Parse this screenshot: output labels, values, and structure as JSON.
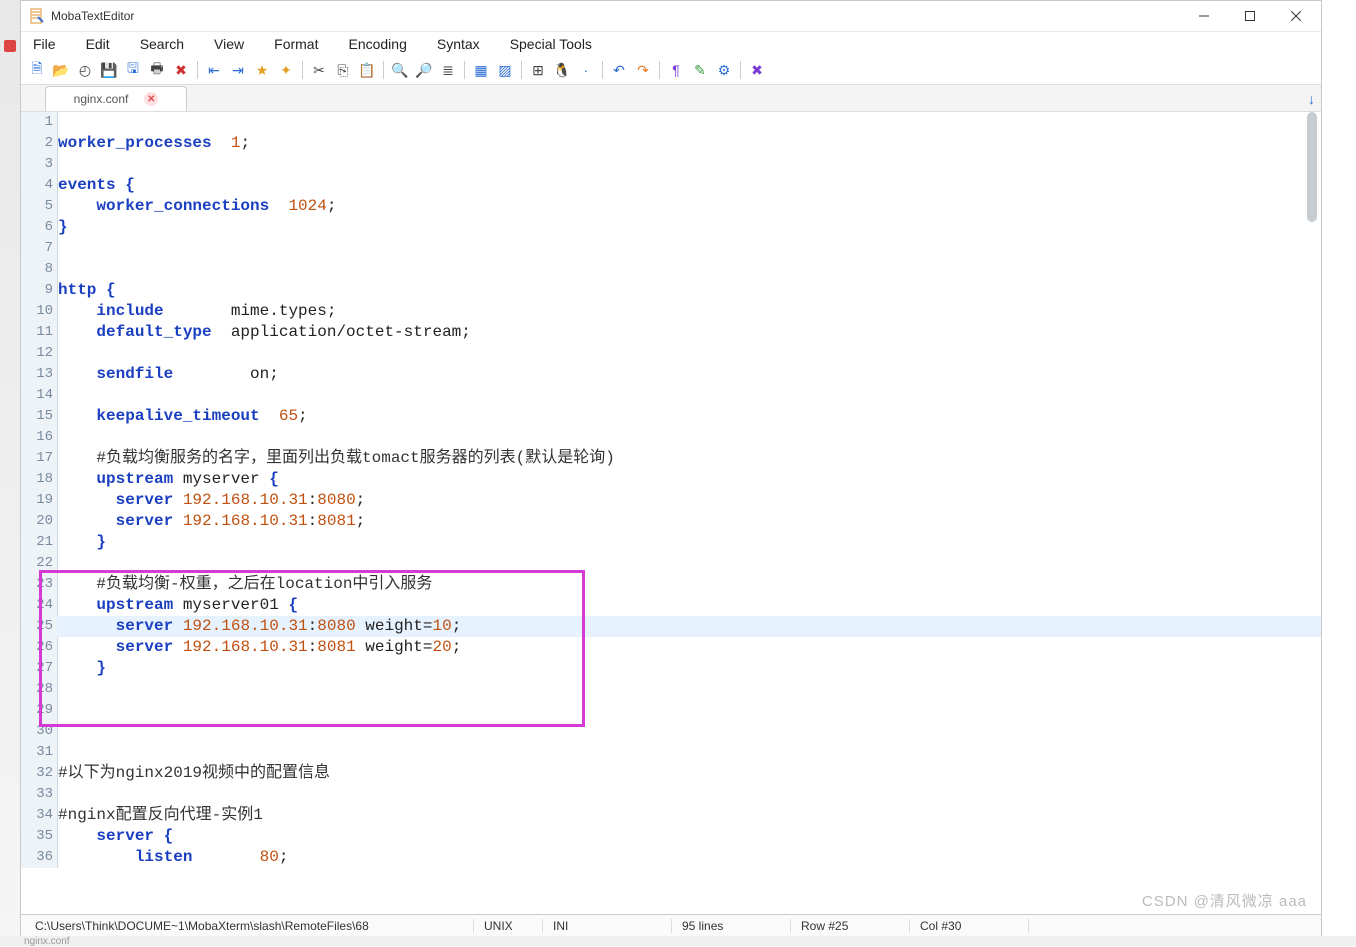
{
  "window": {
    "title": "MobaTextEditor"
  },
  "menu": {
    "items": [
      "File",
      "Edit",
      "Search",
      "View",
      "Format",
      "Encoding",
      "Syntax",
      "Special Tools"
    ]
  },
  "toolbar": {
    "groups": [
      [
        "new-file-icon",
        "open-folder-icon",
        "reload-icon",
        "save-icon",
        "save-all-icon",
        "print-icon",
        "close-icon"
      ],
      [
        "outdent-icon",
        "indent-icon",
        "bookmark-icon",
        "bookmark-add-icon"
      ],
      [
        "cut-icon",
        "copy-icon",
        "paste-icon"
      ],
      [
        "search-icon",
        "find-replace-icon",
        "list-icon"
      ],
      [
        "win-to-unix-icon",
        "unix-to-win-icon"
      ],
      [
        "windows-icon",
        "linux-icon",
        "apple-icon"
      ],
      [
        "undo-icon",
        "redo-icon"
      ],
      [
        "pilcrow-icon",
        "highlight-icon",
        "settings-gear-icon"
      ],
      [
        "exit-app-icon"
      ]
    ],
    "glyphs": {
      "new-file-icon": "🗎",
      "open-folder-icon": "📂",
      "reload-icon": "◴",
      "save-icon": "💾",
      "save-all-icon": "🖫",
      "print-icon": "🖶",
      "close-icon": "✖",
      "outdent-icon": "⇤",
      "indent-icon": "⇥",
      "bookmark-icon": "★",
      "bookmark-add-icon": "✦",
      "cut-icon": "✂",
      "copy-icon": "⎘",
      "paste-icon": "📋",
      "search-icon": "🔍",
      "find-replace-icon": "🔎",
      "list-icon": "≣",
      "win-to-unix-icon": "▦",
      "unix-to-win-icon": "▨",
      "windows-icon": "⊞",
      "linux-icon": "🐧",
      "apple-icon": "",
      "undo-icon": "↶",
      "redo-icon": "↷",
      "pilcrow-icon": "¶",
      "highlight-icon": "✎",
      "settings-gear-icon": "⚙",
      "exit-app-icon": "✖"
    },
    "colors": {
      "new-file-icon": "blue",
      "open-folder-icon": "yellow",
      "reload-icon": "",
      "save-icon": "blue",
      "save-all-icon": "blue",
      "print-icon": "",
      "close-icon": "red",
      "outdent-icon": "blue",
      "indent-icon": "blue",
      "bookmark-icon": "yellow",
      "bookmark-add-icon": "yellow",
      "cut-icon": "",
      "copy-icon": "",
      "paste-icon": "",
      "search-icon": "blue",
      "find-replace-icon": "blue",
      "list-icon": "",
      "win-to-unix-icon": "blue",
      "unix-to-win-icon": "blue",
      "windows-icon": "",
      "linux-icon": "orange",
      "apple-icon": "blue",
      "undo-icon": "blue",
      "redo-icon": "orange",
      "pilcrow-icon": "purple",
      "highlight-icon": "green",
      "settings-gear-icon": "blue",
      "exit-app-icon": "purple"
    }
  },
  "tab": {
    "name": "nginx.conf"
  },
  "code": {
    "current_line_index": 24,
    "highlight_box": {
      "first_line_index": 22,
      "last_line_index": 28
    },
    "lines": [
      {
        "n": 1,
        "spans": []
      },
      {
        "n": 2,
        "spans": [
          {
            "c": "kw",
            "t": "worker_processes"
          },
          {
            "c": "txt",
            "t": "  "
          },
          {
            "c": "num",
            "t": "1"
          },
          {
            "c": "txt",
            "t": ";"
          }
        ]
      },
      {
        "n": 3,
        "spans": []
      },
      {
        "n": 4,
        "spans": [
          {
            "c": "kw",
            "t": "events"
          },
          {
            "c": "txt",
            "t": " "
          },
          {
            "c": "brace",
            "t": "{"
          }
        ]
      },
      {
        "n": 5,
        "spans": [
          {
            "c": "txt",
            "t": "    "
          },
          {
            "c": "kw",
            "t": "worker_connections"
          },
          {
            "c": "txt",
            "t": "  "
          },
          {
            "c": "num",
            "t": "1024"
          },
          {
            "c": "txt",
            "t": ";"
          }
        ]
      },
      {
        "n": 6,
        "spans": [
          {
            "c": "brace",
            "t": "}"
          }
        ]
      },
      {
        "n": 7,
        "spans": []
      },
      {
        "n": 8,
        "spans": []
      },
      {
        "n": 9,
        "spans": [
          {
            "c": "kw",
            "t": "http"
          },
          {
            "c": "txt",
            "t": " "
          },
          {
            "c": "brace",
            "t": "{"
          }
        ]
      },
      {
        "n": 10,
        "spans": [
          {
            "c": "txt",
            "t": "    "
          },
          {
            "c": "kw",
            "t": "include"
          },
          {
            "c": "txt",
            "t": "       mime.types;"
          }
        ]
      },
      {
        "n": 11,
        "spans": [
          {
            "c": "txt",
            "t": "    "
          },
          {
            "c": "kw",
            "t": "default_type"
          },
          {
            "c": "txt",
            "t": "  application/octet-stream;"
          }
        ]
      },
      {
        "n": 12,
        "spans": []
      },
      {
        "n": 13,
        "spans": [
          {
            "c": "txt",
            "t": "    "
          },
          {
            "c": "kw",
            "t": "sendfile"
          },
          {
            "c": "txt",
            "t": "        on;"
          }
        ]
      },
      {
        "n": 14,
        "spans": []
      },
      {
        "n": 15,
        "spans": [
          {
            "c": "txt",
            "t": "    "
          },
          {
            "c": "kw",
            "t": "keepalive_timeout"
          },
          {
            "c": "txt",
            "t": "  "
          },
          {
            "c": "num",
            "t": "65"
          },
          {
            "c": "txt",
            "t": ";"
          }
        ]
      },
      {
        "n": 16,
        "spans": []
      },
      {
        "n": 17,
        "spans": [
          {
            "c": "txt",
            "t": "    "
          },
          {
            "c": "cmt",
            "t": "#负载均衡服务的名字，里面列出负载tomact服务器的列表(默认是轮询)"
          }
        ]
      },
      {
        "n": 18,
        "spans": [
          {
            "c": "txt",
            "t": "    "
          },
          {
            "c": "kw",
            "t": "upstream"
          },
          {
            "c": "txt",
            "t": " myserver "
          },
          {
            "c": "brace",
            "t": "{"
          }
        ]
      },
      {
        "n": 19,
        "spans": [
          {
            "c": "txt",
            "t": "      "
          },
          {
            "c": "kw",
            "t": "server"
          },
          {
            "c": "txt",
            "t": " "
          },
          {
            "c": "num",
            "t": "192.168.10.31"
          },
          {
            "c": "txt",
            "t": ":"
          },
          {
            "c": "num",
            "t": "8080"
          },
          {
            "c": "txt",
            "t": ";"
          }
        ]
      },
      {
        "n": 20,
        "spans": [
          {
            "c": "txt",
            "t": "      "
          },
          {
            "c": "kw",
            "t": "server"
          },
          {
            "c": "txt",
            "t": " "
          },
          {
            "c": "num",
            "t": "192.168.10.31"
          },
          {
            "c": "txt",
            "t": ":"
          },
          {
            "c": "num",
            "t": "8081"
          },
          {
            "c": "txt",
            "t": ";"
          }
        ]
      },
      {
        "n": 21,
        "spans": [
          {
            "c": "txt",
            "t": "    "
          },
          {
            "c": "brace",
            "t": "}"
          }
        ]
      },
      {
        "n": 22,
        "spans": []
      },
      {
        "n": 23,
        "spans": [
          {
            "c": "txt",
            "t": "    "
          },
          {
            "c": "cmt",
            "t": "#负载均衡-权重，之后在location中引入服务"
          }
        ]
      },
      {
        "n": 24,
        "spans": [
          {
            "c": "txt",
            "t": "    "
          },
          {
            "c": "kw",
            "t": "upstream"
          },
          {
            "c": "txt",
            "t": " myserver01 "
          },
          {
            "c": "brace",
            "t": "{"
          }
        ]
      },
      {
        "n": 25,
        "spans": [
          {
            "c": "txt",
            "t": "      "
          },
          {
            "c": "kw",
            "t": "server"
          },
          {
            "c": "txt",
            "t": " "
          },
          {
            "c": "num",
            "t": "192.168.10.31"
          },
          {
            "c": "txt",
            "t": ":"
          },
          {
            "c": "num",
            "t": "8080"
          },
          {
            "c": "txt",
            "t": " weight="
          },
          {
            "c": "num",
            "t": "10"
          },
          {
            "c": "txt",
            "t": ";"
          }
        ]
      },
      {
        "n": 26,
        "spans": [
          {
            "c": "txt",
            "t": "      "
          },
          {
            "c": "kw",
            "t": "server"
          },
          {
            "c": "txt",
            "t": " "
          },
          {
            "c": "num",
            "t": "192.168.10.31"
          },
          {
            "c": "txt",
            "t": ":"
          },
          {
            "c": "num",
            "t": "8081"
          },
          {
            "c": "txt",
            "t": " weight="
          },
          {
            "c": "num",
            "t": "20"
          },
          {
            "c": "txt",
            "t": ";"
          }
        ]
      },
      {
        "n": 27,
        "spans": [
          {
            "c": "txt",
            "t": "    "
          },
          {
            "c": "brace",
            "t": "}"
          }
        ]
      },
      {
        "n": 28,
        "spans": []
      },
      {
        "n": 29,
        "spans": []
      },
      {
        "n": 30,
        "spans": []
      },
      {
        "n": 31,
        "spans": []
      },
      {
        "n": 32,
        "spans": [
          {
            "c": "cmt",
            "t": "#以下为nginx2019视频中的配置信息"
          }
        ]
      },
      {
        "n": 33,
        "spans": []
      },
      {
        "n": 34,
        "spans": [
          {
            "c": "cmt",
            "t": "#nginx配置反向代理-实例1"
          }
        ]
      },
      {
        "n": 35,
        "spans": [
          {
            "c": "txt",
            "t": "    "
          },
          {
            "c": "kw",
            "t": "server"
          },
          {
            "c": "txt",
            "t": " "
          },
          {
            "c": "brace",
            "t": "{"
          }
        ]
      },
      {
        "n": 36,
        "spans": [
          {
            "c": "txt",
            "t": "        "
          },
          {
            "c": "kw",
            "t": "listen"
          },
          {
            "c": "txt",
            "t": "       "
          },
          {
            "c": "num",
            "t": "80"
          },
          {
            "c": "txt",
            "t": ";"
          }
        ]
      }
    ]
  },
  "status": {
    "path": "C:\\Users\\Think\\DOCUME~1\\MobaXterm\\slash\\RemoteFiles\\68",
    "eol": "UNIX",
    "filetype": "INI",
    "lines": "95 lines",
    "row": "Row #25",
    "col": "Col #30"
  },
  "watermark": "CSDN @清风微凉 aaa",
  "bottomstrip": "nginx.conf"
}
